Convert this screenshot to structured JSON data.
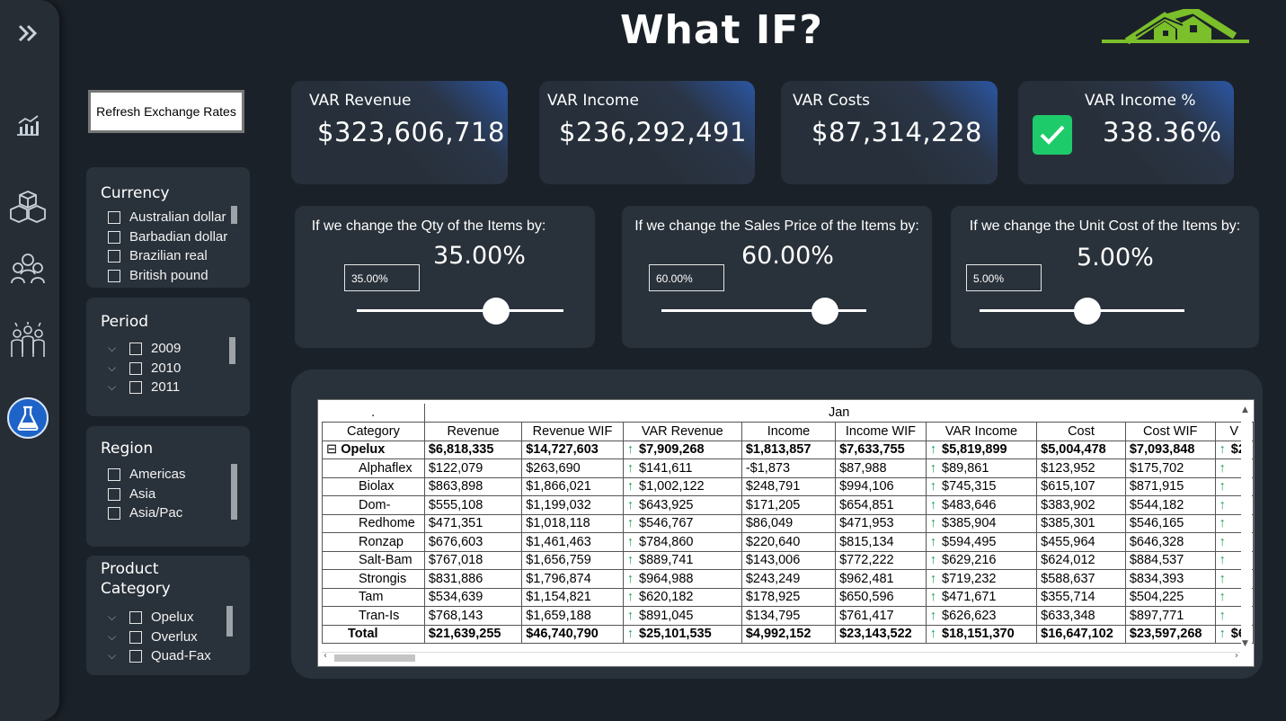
{
  "title": "What IF?",
  "refresh_button": "Refresh Exchange Rates",
  "slicers": {
    "currency": {
      "header": "Currency",
      "options": [
        "Australian dollar",
        "Barbadian dollar",
        "Brazilian real",
        "British pound"
      ]
    },
    "period": {
      "header": "Period",
      "options": [
        "2009",
        "2010",
        "2011"
      ]
    },
    "region": {
      "header": "Region",
      "options": [
        "Americas",
        "Asia",
        "Asia/Pac"
      ]
    },
    "product_category": {
      "header": "Product Category",
      "header_line1": "Product",
      "header_line2": "Category",
      "options": [
        "Opelux",
        "Overlux",
        "Quad-Fax"
      ]
    }
  },
  "kpis": [
    {
      "label": "VAR Revenue",
      "value": "$323,606,718"
    },
    {
      "label": "VAR Income",
      "value": "$236,292,491"
    },
    {
      "label": "VAR Costs",
      "value": "$87,314,228"
    },
    {
      "label": "VAR Income %",
      "value": "338.36%",
      "status_icon": "check-icon",
      "status_color": "#1ecb6a"
    }
  ],
  "what_if": [
    {
      "question": "If we change the Qty of the Items by:",
      "display": "35.00%",
      "input": "35.00%",
      "value": 0.35
    },
    {
      "question": "If we change the Sales Price of the Items by:",
      "display": "60.00%",
      "input": "60.00%",
      "value": 0.6
    },
    {
      "question": "If we change the Unit Cost of the Items by:",
      "display": "5.00%",
      "input": "5.00%",
      "value": 0.05
    }
  ],
  "matrix": {
    "dot": ".",
    "period_header": "Jan",
    "columns": [
      "Category",
      "Revenue",
      "Revenue WIF",
      "VAR Revenue",
      "Income",
      "Income WIF",
      "VAR Income",
      "Cost",
      "Cost WIF",
      "V"
    ],
    "group": {
      "expand_icon": "⊟",
      "name": "Opelux",
      "values": [
        "$6,818,335",
        "$14,727,603",
        "$7,909,268",
        "$1,813,857",
        "$7,633,755",
        "$5,819,899",
        "$5,004,478",
        "$7,093,848",
        "$2,"
      ]
    },
    "rows": [
      {
        "name": "Alphaflex",
        "values": [
          "$122,079",
          "$263,690",
          "$141,611",
          "-$1,873",
          "$87,988",
          "$89,861",
          "$123,952",
          "$175,702"
        ]
      },
      {
        "name": "Biolax",
        "values": [
          "$863,898",
          "$1,866,021",
          "$1,002,122",
          "$248,791",
          "$994,106",
          "$745,315",
          "$615,107",
          "$871,915"
        ]
      },
      {
        "name": "Dom-",
        "values": [
          "$555,108",
          "$1,199,032",
          "$643,925",
          "$171,205",
          "$654,851",
          "$483,646",
          "$383,902",
          "$544,182"
        ]
      },
      {
        "name": "Redhome",
        "values": [
          "$471,351",
          "$1,018,118",
          "$546,767",
          "$86,049",
          "$471,953",
          "$385,904",
          "$385,301",
          "$546,165"
        ]
      },
      {
        "name": "Ronzap",
        "values": [
          "$676,603",
          "$1,461,463",
          "$784,860",
          "$220,640",
          "$815,134",
          "$594,495",
          "$455,964",
          "$646,328"
        ]
      },
      {
        "name": "Salt-Bam",
        "values": [
          "$767,018",
          "$1,656,759",
          "$889,741",
          "$143,006",
          "$772,222",
          "$629,216",
          "$624,012",
          "$884,537"
        ]
      },
      {
        "name": "Strongis",
        "values": [
          "$831,886",
          "$1,796,874",
          "$964,988",
          "$243,249",
          "$962,481",
          "$719,232",
          "$588,637",
          "$834,393"
        ]
      },
      {
        "name": "Tam",
        "values": [
          "$534,639",
          "$1,154,821",
          "$620,182",
          "$178,925",
          "$650,596",
          "$471,671",
          "$355,714",
          "$504,225"
        ]
      },
      {
        "name": "Tran-Is",
        "values": [
          "$768,143",
          "$1,659,188",
          "$891,045",
          "$134,795",
          "$761,417",
          "$626,623",
          "$633,348",
          "$897,771"
        ]
      }
    ],
    "total": {
      "name": "Total",
      "values": [
        "$21,639,255",
        "$46,740,790",
        "$25,101,535",
        "$4,992,152",
        "$23,143,522",
        "$18,151,370",
        "$16,647,102",
        "$23,597,268",
        "$6,"
      ]
    },
    "arrow_icon": "↑",
    "arrow_color": "#1e9e50"
  }
}
